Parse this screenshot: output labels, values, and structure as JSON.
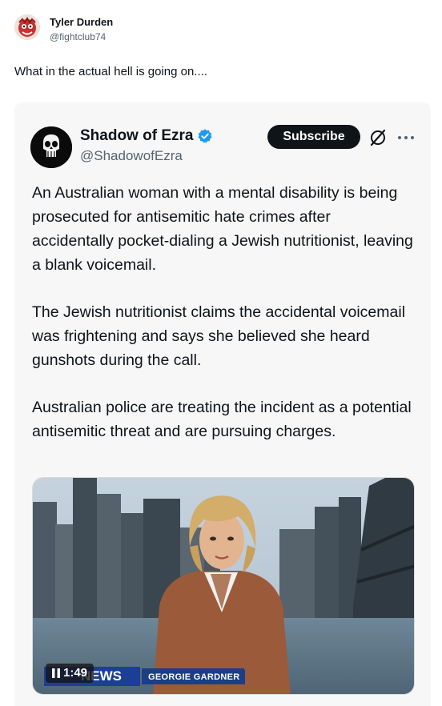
{
  "post": {
    "author_name": "Tyler Durden",
    "author_handle": "@fightclub74",
    "text": "What in the actual hell is going on...."
  },
  "embed": {
    "author_name": "Shadow of Ezra",
    "author_handle": "@ShadowofEzra",
    "subscribe_label": "Subscribe",
    "paragraphs": [
      "An Australian woman with a mental disability is being prosecuted for antisemitic hate crimes after accidentally pocket-dialing a Jewish nutritionist, leaving a blank voicemail.",
      "The Jewish nutritionist claims the accidental voicemail was frightening and says she believed she heard gunshots during the call.",
      "Australian police are treating the incident as a potential antisemitic threat and are pursuing charges."
    ],
    "video": {
      "timestamp": "1:49",
      "channel_logo": "NEWS",
      "ticker_name": "GEORGIE GARDNER"
    }
  },
  "colors": {
    "verified_blue": "#1d9bf0",
    "text_primary": "#0f1419",
    "text_secondary": "#536471",
    "ticker_blue": "#1c3d87"
  }
}
